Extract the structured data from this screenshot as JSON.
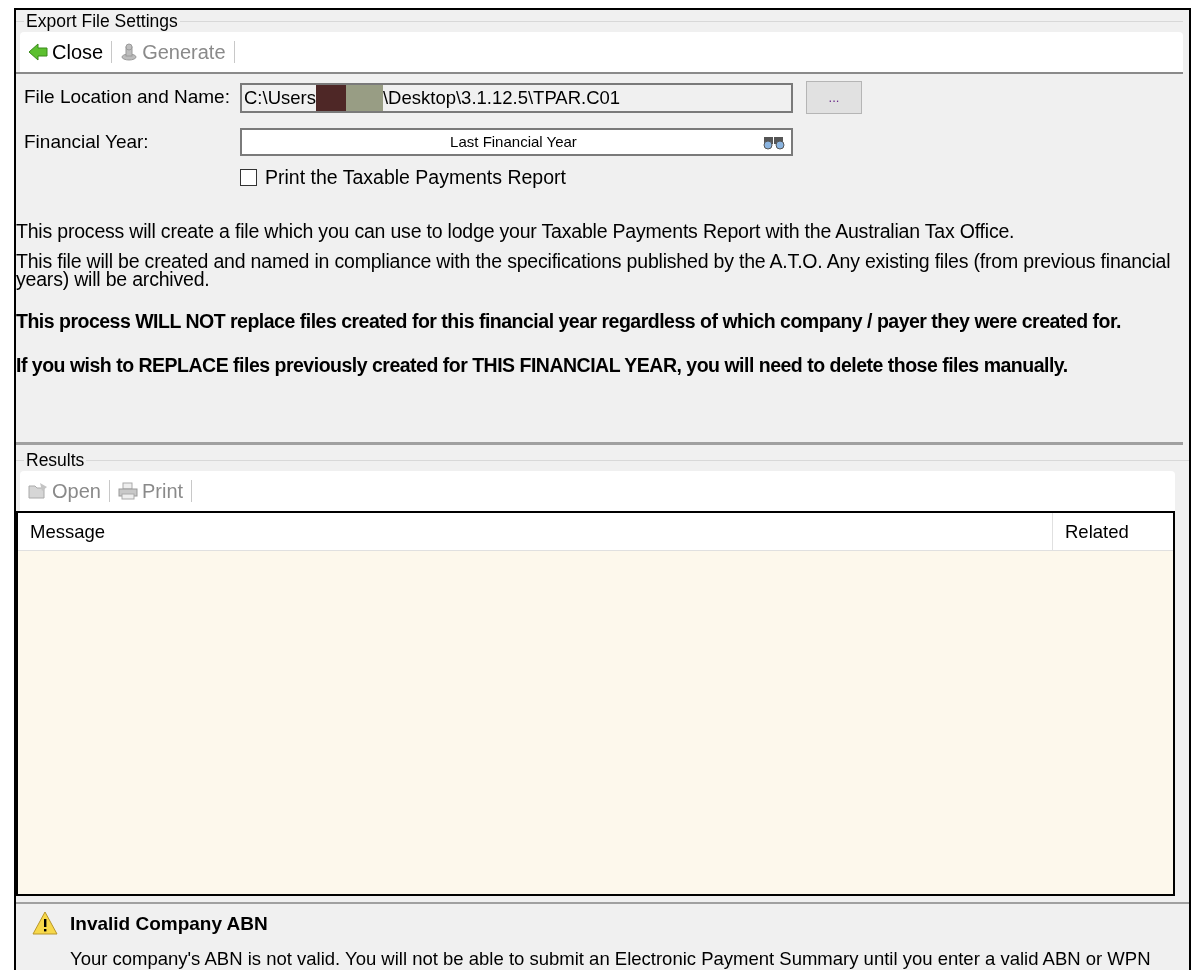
{
  "settings_group": {
    "title": "Export File Settings",
    "toolbar": [
      {
        "label": "Close",
        "kind": "close",
        "disabled": false
      },
      {
        "label": "Generate",
        "kind": "generate",
        "disabled": true
      }
    ],
    "file_location": {
      "label": "File Location and Name:",
      "value_start": "C:\\Users",
      "value_end": "\\Desktop\\3.1.12.5\\TPAR.C01",
      "browse": "..."
    },
    "financial_year": {
      "label": "Financial Year:",
      "value": "Last Financial Year"
    },
    "print_report": {
      "label": "Print the Taxable Payments Report",
      "checked": false
    },
    "paragraphs": [
      {
        "text": "This process will create a file which you can use to lodge your Taxable Payments Report with the Australian Tax Office.",
        "bold": false
      },
      {
        "text": "This file will be created and named in compliance with the specifications published by the A.T.O. Any existing files (from previous financial years) will be archived.",
        "bold": false
      },
      {
        "text": "This process WILL NOT replace files created for this financial year regardless of which company / payer they were created for.",
        "bold": true
      },
      {
        "text": "If you wish to REPLACE files previously created for THIS FINANCIAL YEAR, you will need to delete those files manually.",
        "bold": true
      }
    ]
  },
  "results_group": {
    "title": "Results",
    "toolbar": [
      {
        "label": "Open",
        "kind": "open",
        "disabled": true
      },
      {
        "label": "Print",
        "kind": "print",
        "disabled": true
      }
    ],
    "table": {
      "columns": [
        "Message",
        "Related"
      ]
    }
  },
  "warning": {
    "title": "Invalid Company ABN",
    "message": "Your company's ABN is not valid. You will not be able to submit an Electronic Payment Summary until you enter a valid ABN or WPN"
  }
}
